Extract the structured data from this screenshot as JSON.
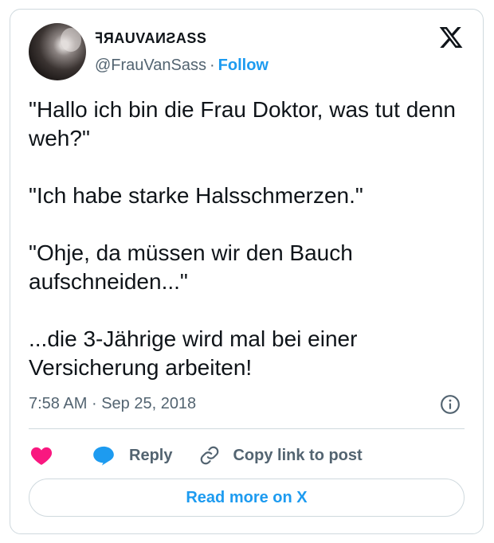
{
  "author": {
    "display_name": "ꟻЯAUVAИƧASS",
    "handle": "@FrauVanSass",
    "separator": "·",
    "follow_label": "Follow"
  },
  "tweet": {
    "text": "\"Hallo ich bin die Frau Doktor, was tut denn weh?\"\n\n\"Ich habe starke Halsschmerzen.\"\n\n\"Ohje, da müssen wir den Bauch aufschneiden...\"\n\n...die 3-Jährige wird mal bei einer Versicherung arbeiten!",
    "time": "7:58 AM",
    "separator": "·",
    "date": "Sep 25, 2018"
  },
  "actions": {
    "reply_label": "Reply",
    "copy_link_label": "Copy link to post"
  },
  "read_more_label": "Read more on X",
  "icons": {
    "like": "heart-icon",
    "reply": "speech-bubble-icon",
    "copy": "link-icon",
    "info": "info-icon",
    "brand": "x-logo-icon"
  },
  "colors": {
    "accent": "#1d9bf0",
    "like": "#f91880",
    "text": "#0f1419",
    "muted": "#536471",
    "border": "#cfd9de"
  }
}
